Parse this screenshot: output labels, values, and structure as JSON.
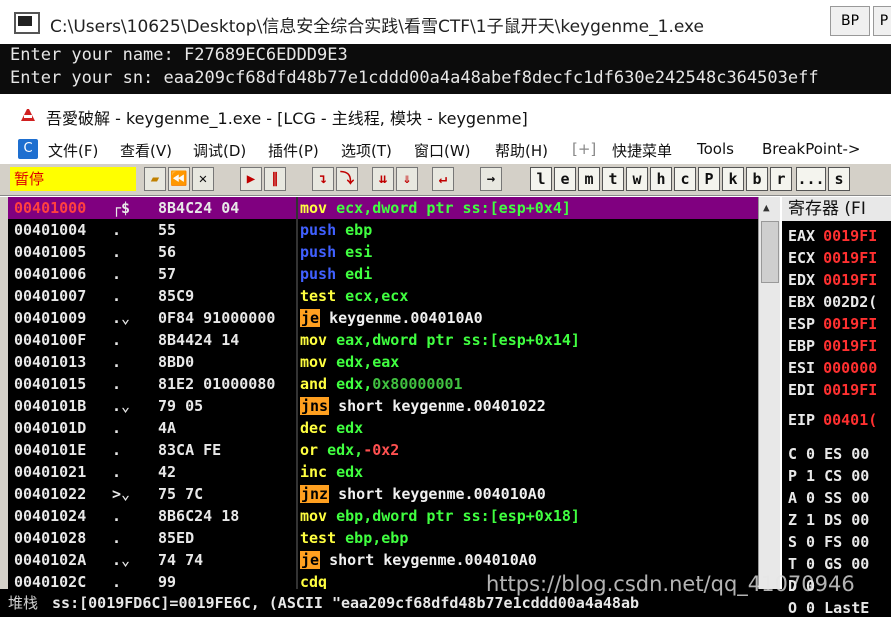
{
  "console": {
    "title": "C:\\Users\\10625\\Desktop\\信息安全综合实践\\看雪CTF\\1子鼠开天\\keygenme_1.exe",
    "bp_button": "BP",
    "p_button": "P",
    "lines": [
      "Enter your name: F27689EC6EDDD9E3",
      "Enter your sn: eaa209cf68dfd48b77e1cddd00a4a48abef8decfc1df630e242548c364503eff"
    ]
  },
  "od": {
    "title": "吾愛破解 - keygenme_1.exe - [LCG - 主线程, 模块 - keygenme]",
    "menu": [
      "文件(F)",
      "查看(V)",
      "调试(D)",
      "插件(P)",
      "选项(T)",
      "窗口(W)",
      "帮助(H)",
      "[+]",
      "快捷菜单",
      "Tools",
      "BreakPoint->"
    ],
    "menu_icon": "C",
    "status": "暂停",
    "toolbar_letters": [
      "l",
      "e",
      "m",
      "t",
      "w",
      "h",
      "c",
      "P",
      "k",
      "b",
      "r",
      "...",
      "s"
    ]
  },
  "disasm": [
    {
      "addr": "00401000",
      "mark": "┌$",
      "hex": "8B4C24 04",
      "mn": "mov",
      "ops": [
        {
          "t": "ecx,dword ptr ss:[esp+0x4]",
          "c": "op"
        }
      ],
      "sel": true
    },
    {
      "addr": "00401004",
      "mark": ".",
      "hex": "55",
      "mn": "push",
      "mnc": "blue",
      "ops": [
        {
          "t": "ebp",
          "c": "op"
        }
      ]
    },
    {
      "addr": "00401005",
      "mark": ".",
      "hex": "56",
      "mn": "push",
      "mnc": "blue",
      "ops": [
        {
          "t": "esi",
          "c": "op"
        }
      ]
    },
    {
      "addr": "00401006",
      "mark": ".",
      "hex": "57",
      "mn": "push",
      "mnc": "blue",
      "ops": [
        {
          "t": "edi",
          "c": "op"
        }
      ]
    },
    {
      "addr": "00401007",
      "mark": ".",
      "hex": "85C9",
      "mn": "test",
      "ops": [
        {
          "t": "ecx,ecx",
          "c": "op"
        }
      ]
    },
    {
      "addr": "00401009",
      "mark": ".⌄",
      "hex": "0F84 91000000",
      "mn": "je",
      "mnc": "jump",
      "ops": [
        {
          "t": "keygenme.004010A0",
          "c": "op white"
        }
      ]
    },
    {
      "addr": "0040100F",
      "mark": ".",
      "hex": "8B4424 14",
      "mn": "mov",
      "ops": [
        {
          "t": "eax,dword ptr ss:[esp+0x14]",
          "c": "op"
        }
      ]
    },
    {
      "addr": "00401013",
      "mark": ".",
      "hex": "8BD0",
      "mn": "mov",
      "ops": [
        {
          "t": "edx,eax",
          "c": "op"
        }
      ]
    },
    {
      "addr": "00401015",
      "mark": ".",
      "hex": "81E2 01000080",
      "mn": "and",
      "ops": [
        {
          "t": "edx,",
          "c": "op"
        },
        {
          "t": "0x80000001",
          "c": "imm"
        }
      ]
    },
    {
      "addr": "0040101B",
      "mark": ".⌄",
      "hex": "79 05",
      "mn": "jns",
      "mnc": "jump",
      "ops": [
        {
          "t": "short keygenme.00401022",
          "c": "op white"
        }
      ]
    },
    {
      "addr": "0040101D",
      "mark": ".",
      "hex": "4A",
      "mn": "dec",
      "ops": [
        {
          "t": "edx",
          "c": "op"
        }
      ]
    },
    {
      "addr": "0040101E",
      "mark": ".",
      "hex": "83CA FE",
      "mn": "or",
      "ops": [
        {
          "t": "edx,",
          "c": "op"
        },
        {
          "t": "-0x2",
          "c": "neg"
        }
      ]
    },
    {
      "addr": "00401021",
      "mark": ".",
      "hex": "42",
      "mn": "inc",
      "ops": [
        {
          "t": "edx",
          "c": "op"
        }
      ]
    },
    {
      "addr": "00401022",
      "mark": ">⌄",
      "hex": "75 7C",
      "mn": "jnz",
      "mnc": "jump",
      "ops": [
        {
          "t": "short keygenme.004010A0",
          "c": "op white"
        }
      ]
    },
    {
      "addr": "00401024",
      "mark": ".",
      "hex": "8B6C24 18",
      "mn": "mov",
      "ops": [
        {
          "t": "ebp,dword ptr ss:[esp+0x18]",
          "c": "op"
        }
      ]
    },
    {
      "addr": "00401028",
      "mark": ".",
      "hex": "85ED",
      "mn": "test",
      "ops": [
        {
          "t": "ebp,ebp",
          "c": "op"
        }
      ]
    },
    {
      "addr": "0040102A",
      "mark": ".⌄",
      "hex": "74 74",
      "mn": "je",
      "mnc": "jump",
      "ops": [
        {
          "t": "short keygenme.004010A0",
          "c": "op white"
        }
      ]
    },
    {
      "addr": "0040102C",
      "mark": ".",
      "hex": "99",
      "mn": "cdq",
      "ops": []
    }
  ],
  "registers": {
    "header": "寄存器 (FI",
    "regs": [
      {
        "name": "EAX",
        "val": "0019FI"
      },
      {
        "name": "ECX",
        "val": "0019FI"
      },
      {
        "name": "EDX",
        "val": "0019FI"
      },
      {
        "name": "EBX",
        "val": "002D2(",
        "white": true
      },
      {
        "name": "ESP",
        "val": "0019FI"
      },
      {
        "name": "EBP",
        "val": "0019FI"
      },
      {
        "name": "ESI",
        "val": "000000"
      },
      {
        "name": "EDI",
        "val": "0019FI"
      },
      {
        "name": "EIP",
        "val": "00401("
      }
    ],
    "flags": [
      "C 0  ES 00",
      "P 1  CS 00",
      "A 0  SS 00",
      "Z 1  DS 00",
      "S 0  FS 00",
      "T 0  GS 00",
      "D 0",
      "O 0  LastE"
    ]
  },
  "info": {
    "label": "堆栈",
    "text": "ss:[0019FD6C]=0019FE6C, (ASCII \"eaa209cf68dfd48b77e1cddd00a4a48ab"
  },
  "watermark": "https://blog.csdn.net/qq_41070946"
}
